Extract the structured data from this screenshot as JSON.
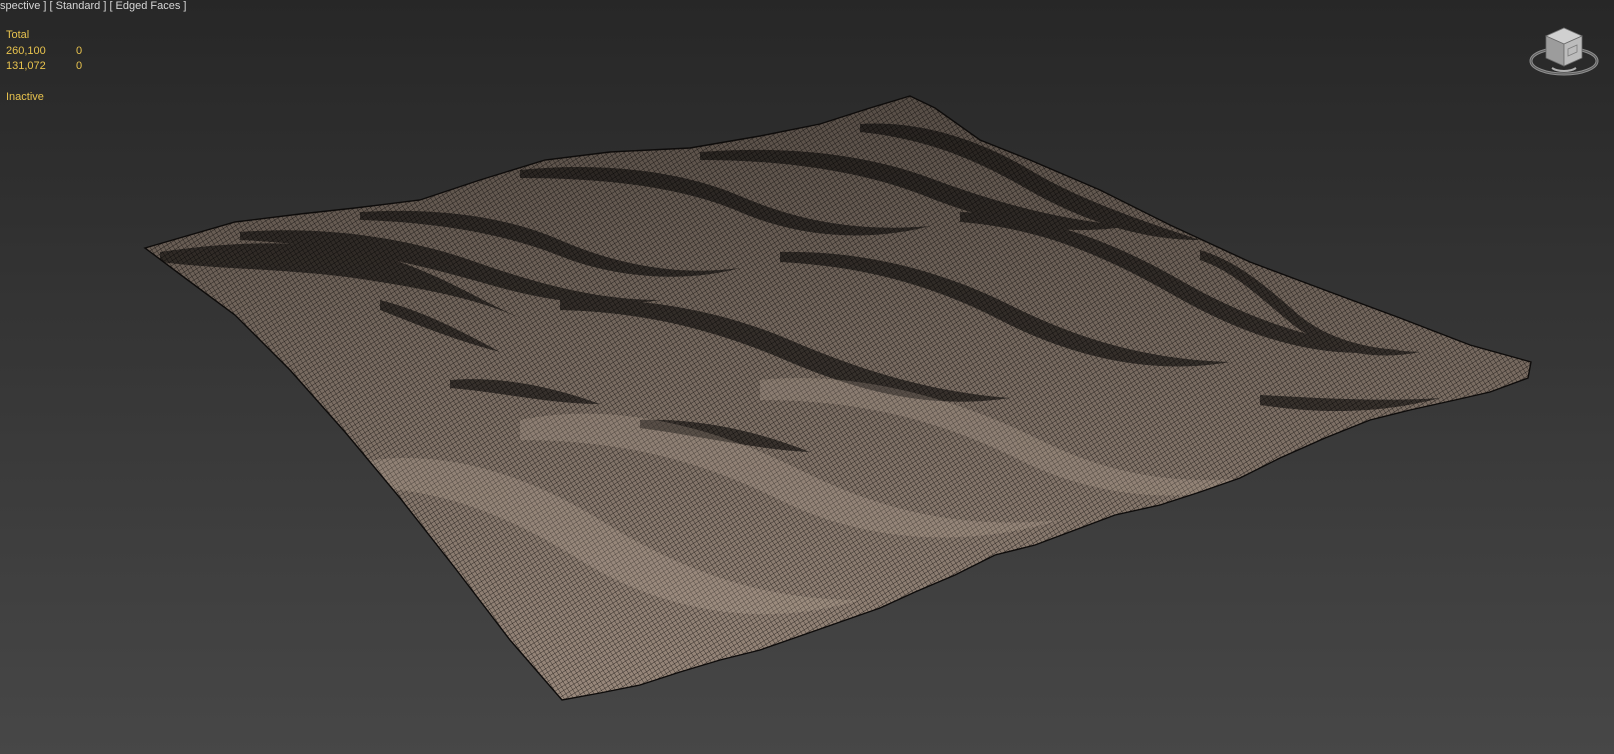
{
  "viewport": {
    "label": "spective ] [ Standard ] [ Edged Faces ]",
    "shading_mode": "Edged Faces",
    "background_top": "#272727",
    "background_bottom": "#474747",
    "mesh_face_color": "#a69486",
    "mesh_edge_color": "#1a1614"
  },
  "statistics": {
    "header": "Total",
    "rows": [
      {
        "value": "260,100",
        "selected": "0"
      },
      {
        "value": "131,072",
        "selected": "0"
      }
    ],
    "status": "Inactive",
    "text_color": "#e8c34e"
  },
  "viewcube": {
    "icon": "viewcube-icon"
  }
}
